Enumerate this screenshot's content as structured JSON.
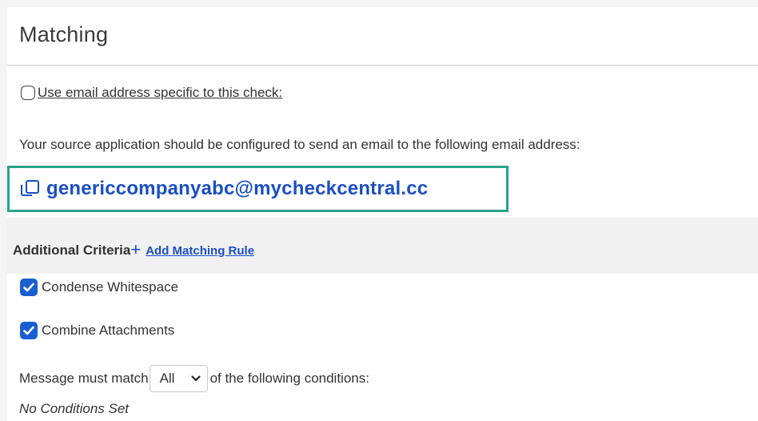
{
  "section": {
    "title": "Matching"
  },
  "use_email": {
    "label": "Use email address specific to this check:",
    "checked": false
  },
  "source_instruction": "Your source application should be configured to send an email to the following email address:",
  "email": {
    "address": "genericcompanyabc@mycheckcentral.cc",
    "icon": "copy-icon",
    "highlight_color": "#2aa38a",
    "link_color": "#1a4fc4"
  },
  "criteria": {
    "title": "Additional Criteria",
    "add_icon": "plus-icon",
    "add_rule_label": "Add Matching Rule"
  },
  "options": [
    {
      "label": "Condense Whitespace",
      "checked": true
    },
    {
      "label": "Combine Attachments",
      "checked": true
    }
  ],
  "match": {
    "prefix": "Message must match",
    "selected": "All",
    "suffix": "of the following conditions:"
  },
  "no_conditions": "No Conditions Set"
}
